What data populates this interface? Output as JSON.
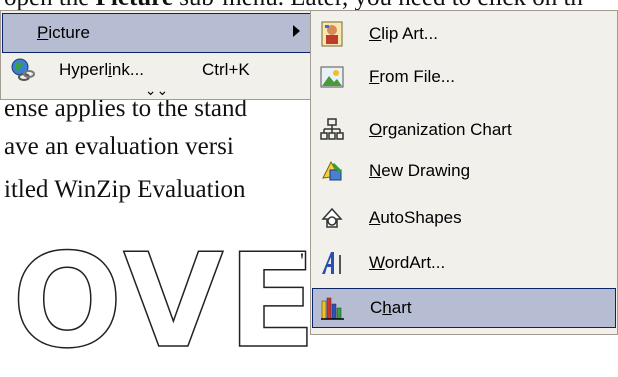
{
  "document": {
    "top_text_pre": "open the ",
    "top_text_bold": "Picture",
    "top_text_post": " sub-menu. Later, you need to click on th",
    "line1": "ense applies to the stand",
    "line2": "ave an evaluation versi",
    "line3": "itled WinZip Evaluation",
    "wordart": "OVE",
    "wordart_tail": "'"
  },
  "insert_menu": {
    "picture": {
      "label_u": "P",
      "label_rest": "icture",
      "icon": "none"
    },
    "hyperlink": {
      "label_pre": "Hyperl",
      "label_u": "i",
      "label_post": "nk...",
      "shortcut": "Ctrl+K",
      "icon": "globe-link-icon"
    },
    "expand": "⌄⌄"
  },
  "picture_menu": {
    "items": [
      {
        "pre": "",
        "u": "C",
        "post": "lip Art...",
        "icon": "clip-art-icon"
      },
      {
        "pre": "",
        "u": "F",
        "post": "rom File...",
        "icon": "from-file-icon"
      },
      {
        "pre": "",
        "u": "O",
        "post": "rganization Chart",
        "icon": "org-chart-icon"
      },
      {
        "pre": "",
        "u": "N",
        "post": "ew Drawing",
        "icon": "new-drawing-icon"
      },
      {
        "pre": "",
        "u": "A",
        "post": "utoShapes",
        "icon": "autoshapes-icon"
      },
      {
        "pre": "",
        "u": "W",
        "post": "ordArt...",
        "icon": "wordart-icon"
      },
      {
        "pre": "C",
        "u": "h",
        "post": "art",
        "icon": "chart-icon"
      }
    ]
  }
}
